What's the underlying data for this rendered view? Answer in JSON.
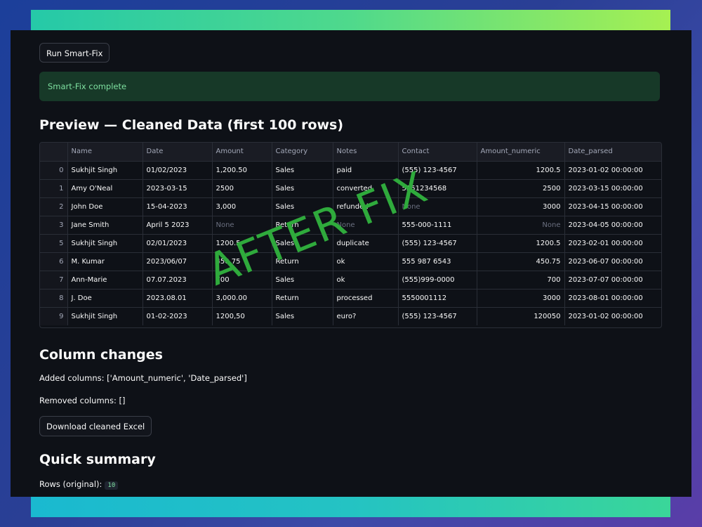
{
  "run_button_label": "Run Smart-Fix",
  "alert_text": "Smart-Fix complete",
  "preview_heading": "Preview — Cleaned Data (first 100 rows)",
  "table": {
    "columns": [
      "",
      "Name",
      "Date",
      "Amount",
      "Category",
      "Notes",
      "Contact",
      "Amount_numeric",
      "Date_parsed"
    ],
    "rows": [
      [
        "0",
        "Sukhjit  Singh",
        "01/02/2023",
        "1,200.50",
        "Sales",
        "paid",
        "(555) 123-4567",
        "1200.5",
        "2023-01-02 00:00:00"
      ],
      [
        "1",
        "Amy O'Neal",
        "2023-03-15",
        "2500",
        "Sales",
        "converted",
        "5551234568",
        "2500",
        "2023-03-15 00:00:00"
      ],
      [
        "2",
        "John Doe",
        "15-04-2023",
        "3,000",
        "Sales",
        "refunded",
        "None",
        "3000",
        "2023-04-15 00:00:00"
      ],
      [
        "3",
        "Jane Smith",
        "April 5 2023",
        "None",
        "Return",
        "None",
        "555-000-1111",
        "None",
        "2023-04-05 00:00:00"
      ],
      [
        "5",
        "Sukhjit Singh",
        "02/01/2023",
        "1200.5",
        "Sales",
        "duplicate",
        "(555) 123-4567",
        "1200.5",
        "2023-02-01 00:00:00"
      ],
      [
        "6",
        "M. Kumar",
        "2023/06/07",
        "450.75",
        "Return",
        "ok",
        "555 987 6543",
        "450.75",
        "2023-06-07 00:00:00"
      ],
      [
        "7",
        "Ann-Marie",
        "07.07.2023",
        "700",
        "Sales",
        "ok",
        "(555)999-0000",
        "700",
        "2023-07-07 00:00:00"
      ],
      [
        "8",
        "J. Doe",
        "2023.08.01",
        "3,000.00",
        "Return",
        "processed",
        "5550001112",
        "3000",
        "2023-08-01 00:00:00"
      ],
      [
        "9",
        "Sukhjit Singh",
        "01-02-2023",
        "1200,50",
        "Sales",
        "euro?",
        "(555) 123-4567",
        "120050",
        "2023-01-02 00:00:00"
      ]
    ]
  },
  "column_changes_heading": "Column changes",
  "added_columns_text": "Added columns: ['Amount_numeric', 'Date_parsed']",
  "removed_columns_text": "Removed columns: []",
  "download_button_label": "Download cleaned Excel",
  "quick_summary_heading": "Quick summary",
  "rows_original_label": "Rows (original):",
  "rows_original_value": "10",
  "watermark_text": "AFTER FIX",
  "colors": {
    "background": "#0e1117",
    "success_bg": "#173928",
    "success_text": "#7ee0a0",
    "watermark": "#2faa3c"
  }
}
